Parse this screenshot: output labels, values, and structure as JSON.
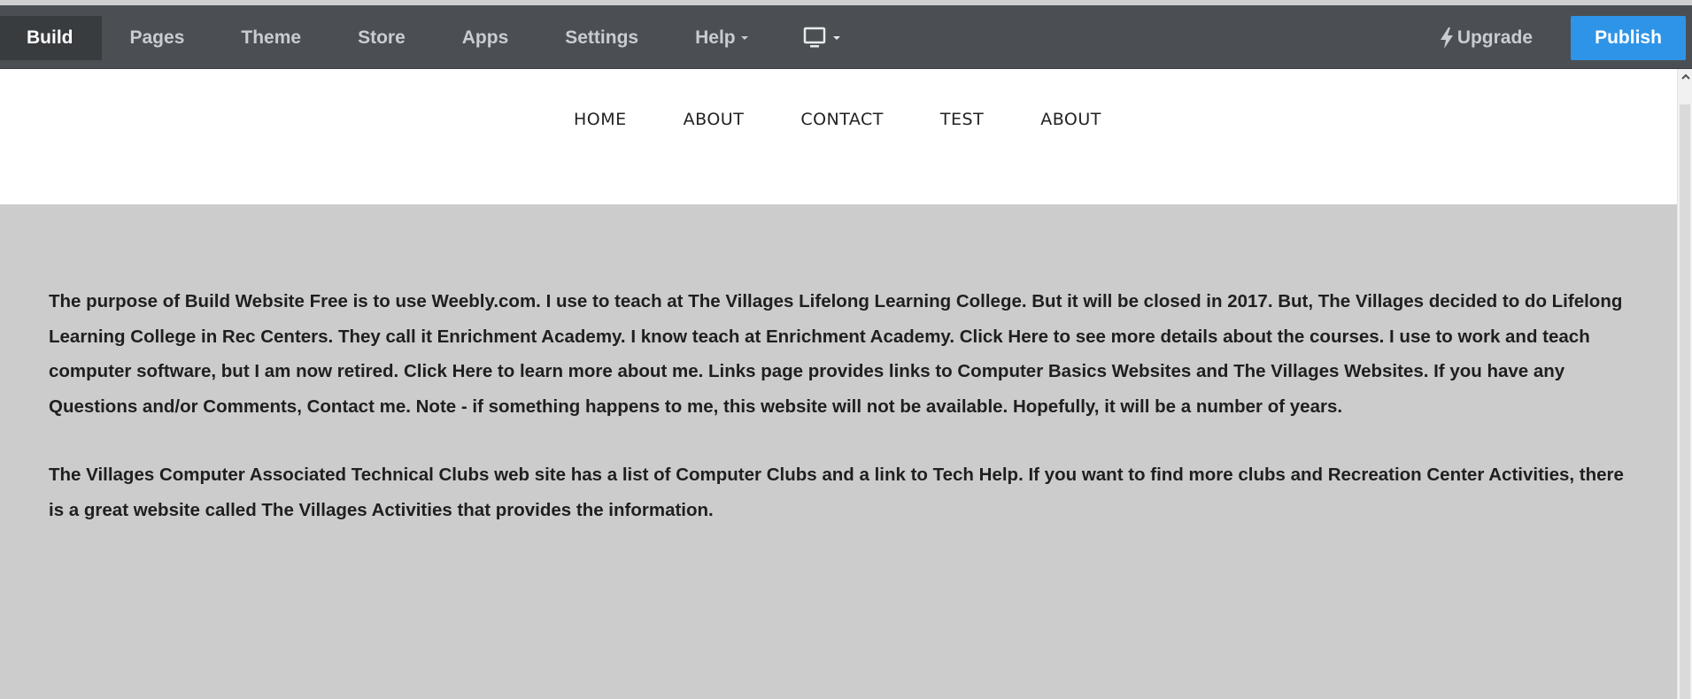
{
  "toolbar": {
    "tabs": [
      {
        "label": "Build",
        "active": true
      },
      {
        "label": "Pages"
      },
      {
        "label": "Theme"
      },
      {
        "label": "Store"
      },
      {
        "label": "Apps"
      },
      {
        "label": "Settings"
      },
      {
        "label": "Help"
      }
    ],
    "device_icon": "desktop-monitor-icon",
    "upgrade_label": "Upgrade",
    "upgrade_icon": "lightning-bolt-icon",
    "publish_label": "Publish",
    "colors": {
      "bar": "#4b4f53",
      "active_tab": "#393c3f",
      "publish": "#2e94e8"
    }
  },
  "site_nav": {
    "items": [
      "HOME",
      "ABOUT",
      "CONTACT",
      "TEST",
      "ABOUT"
    ]
  },
  "content": {
    "paragraph1": "The purpose of Build Website Free is to use Weebly.com.  I use to teach at The Villages Lifelong Learning College. But it will be closed in 2017.  But, The Villages decided to do Lifelong Learning College in Rec Centers.  They call it Enrichment Academy. I know teach at Enrichment Academy.  Click Here to see more details about the courses.  I use to work and teach computer software, but I am now retired.  Click Here to learn more about me.  Links page provides links to Computer Basics Websites and The Villages Websites.  If you have any Questions and/or Comments, Contact me. Note - if something happens to me, this website will not be available.  Hopefully, it will be a number of years.",
    "paragraph2": "The Villages Computer  Associated Technical Clubs web site has a list of Computer Clubs and a link to Tech Help.  If you want to find more clubs and Recreation Center Activities, there is a great website called The Villages Activities that provides the information."
  },
  "scrollbar": {
    "up_icon": "chevron-up-icon"
  }
}
